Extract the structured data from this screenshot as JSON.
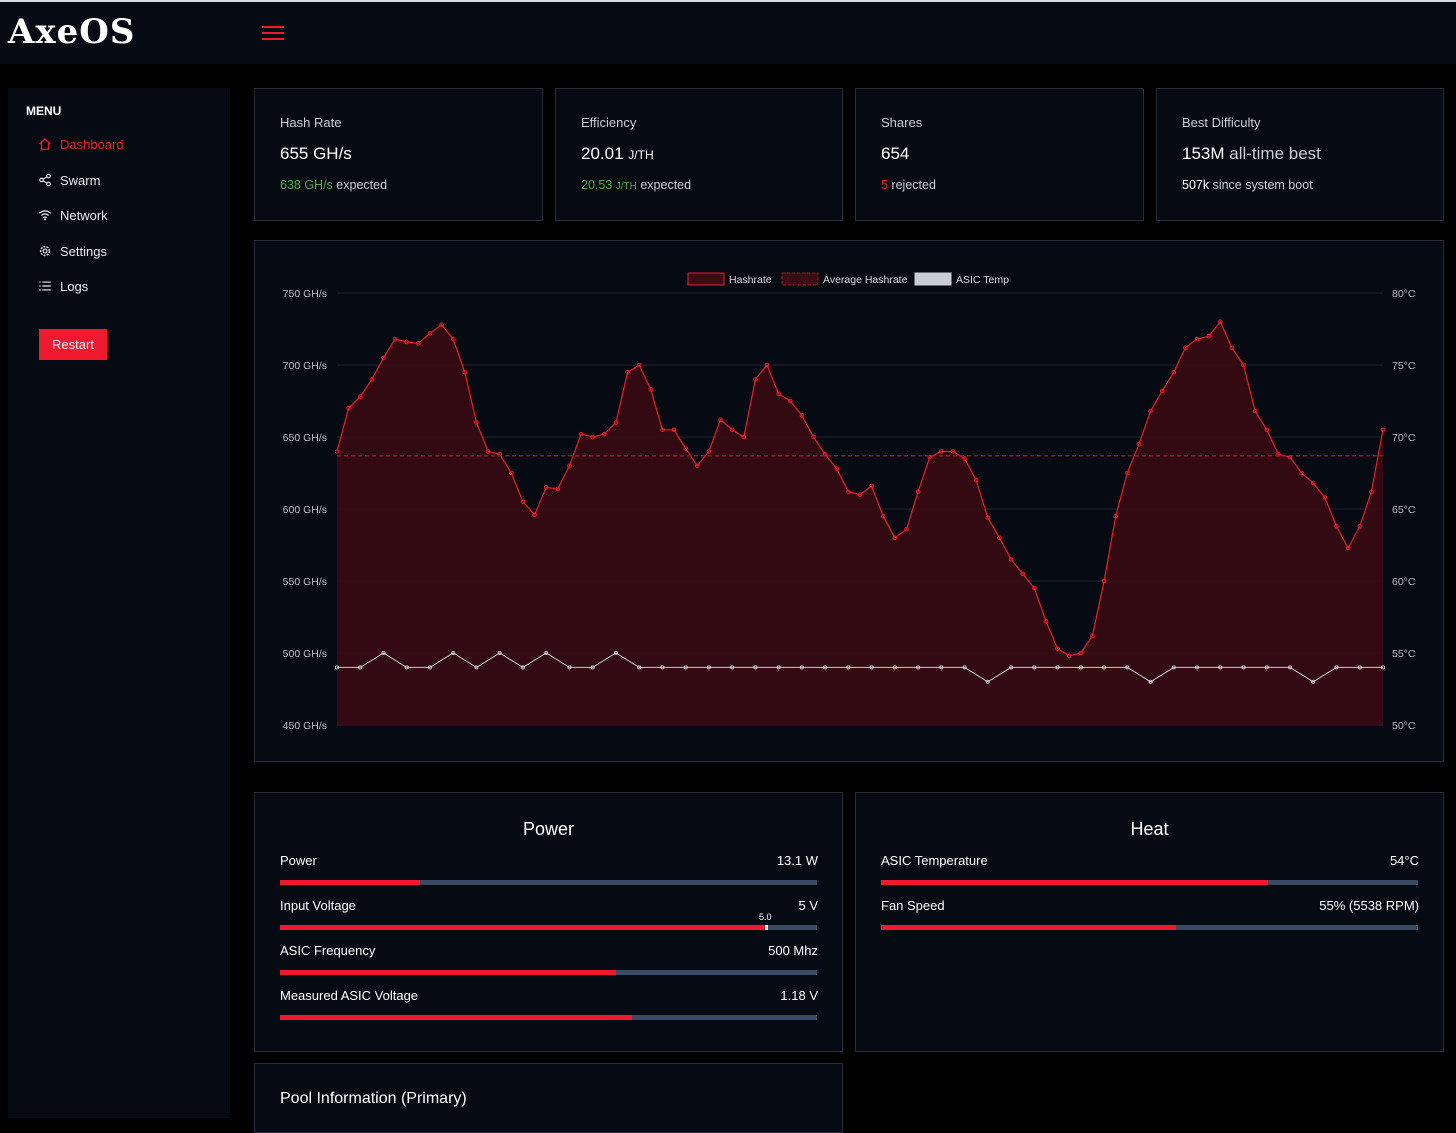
{
  "app": {
    "logo": "AxeOS"
  },
  "sidebar": {
    "menu_title": "MENU",
    "items": [
      {
        "label": "Dashboard",
        "icon": "home-icon",
        "active": true
      },
      {
        "label": "Swarm",
        "icon": "share-icon"
      },
      {
        "label": "Network",
        "icon": "wifi-icon"
      },
      {
        "label": "Settings",
        "icon": "gear-icon"
      },
      {
        "label": "Logs",
        "icon": "list-icon"
      }
    ],
    "restart_label": "Restart"
  },
  "stats": {
    "hashrate": {
      "label": "Hash Rate",
      "value": "655 GH/s",
      "expected_value": "638 GH/s",
      "expected_suffix": " expected"
    },
    "efficiency": {
      "label": "Efficiency",
      "value": "20.01",
      "unit": "J/TH",
      "expected_value": "20.53",
      "expected_unit": "J/TH",
      "expected_suffix": " expected"
    },
    "shares": {
      "label": "Shares",
      "value": "654",
      "rejected_count": "5",
      "rejected_suffix": " rejected"
    },
    "best_difficulty": {
      "label": "Best Difficulty",
      "value": "153M",
      "value_suffix": " all-time best",
      "boot_value": "507k",
      "boot_suffix": " since system boot"
    }
  },
  "chart_data": {
    "type": "line",
    "legend": [
      "Hashrate",
      "Average Hashrate",
      "ASIC Temp"
    ],
    "legend_position": "top-center",
    "y_left": {
      "ticks": [
        "750 GH/s",
        "700 GH/s",
        "650 GH/s",
        "600 GH/s",
        "550 GH/s",
        "500 GH/s",
        "450 GH/s"
      ],
      "range": [
        450,
        750
      ],
      "unit": "GH/s"
    },
    "y_right": {
      "ticks": [
        "80°C",
        "75°C",
        "70°C",
        "65°C",
        "60°C",
        "55°C",
        "50°C"
      ],
      "range": [
        50,
        80
      ],
      "unit": "°C"
    },
    "grid": true,
    "series": [
      {
        "name": "Hashrate",
        "color": "#f0192d",
        "fill": true,
        "values": [
          640,
          670,
          678,
          690,
          705,
          718,
          716,
          715,
          722,
          728,
          718,
          695,
          660,
          640,
          638,
          625,
          605,
          596,
          615,
          614,
          630,
          652,
          650,
          652,
          660,
          695,
          700,
          683,
          655,
          655,
          642,
          630,
          640,
          662,
          655,
          650,
          690,
          700,
          680,
          675,
          665,
          650,
          638,
          628,
          612,
          610,
          616,
          595,
          580,
          586,
          612,
          636,
          640,
          640,
          635,
          620,
          594,
          580,
          565,
          555,
          545,
          522,
          503,
          498,
          500,
          512,
          550,
          595,
          625,
          645,
          668,
          682,
          695,
          712,
          718,
          720,
          730,
          712,
          700,
          668,
          655,
          638,
          636,
          625,
          618,
          608,
          588,
          573,
          588,
          612,
          655
        ]
      },
      {
        "name": "Average Hashrate",
        "color": "#b3121f",
        "dashed": true,
        "values": [
          637
        ]
      },
      {
        "name": "ASIC Temp",
        "color": "#c9cdd4",
        "unit": "°C",
        "typical_value": 54,
        "values": [
          54,
          54,
          55,
          54,
          54,
          55,
          54,
          55,
          54,
          55,
          54,
          54,
          55,
          54,
          54,
          54,
          54,
          54,
          54,
          54,
          54,
          54,
          54,
          54,
          54,
          54,
          54,
          54,
          53,
          54,
          54,
          54,
          54,
          54,
          54,
          53,
          54,
          54,
          54,
          54,
          54,
          54,
          53,
          54,
          54,
          54
        ]
      }
    ]
  },
  "power": {
    "title": "Power",
    "rows": [
      {
        "label": "Power",
        "value": "13.1 W",
        "fraction": 0.26
      },
      {
        "label": "Input Voltage",
        "value": "5 V",
        "fraction": 0.905,
        "marker_label": "5.0"
      },
      {
        "label": "ASIC Frequency",
        "value": "500 Mhz",
        "fraction": 0.625
      },
      {
        "label": "Measured ASIC Voltage",
        "value": "1.18 V",
        "fraction": 0.655
      }
    ]
  },
  "heat": {
    "title": "Heat",
    "rows": [
      {
        "label": "ASIC Temperature",
        "value": "54°C",
        "fraction": 0.72
      },
      {
        "label": "Fan Speed",
        "value": "55% (5538 RPM)",
        "fraction": 0.55
      }
    ]
  },
  "pool": {
    "title": "Pool Information (Primary)"
  }
}
